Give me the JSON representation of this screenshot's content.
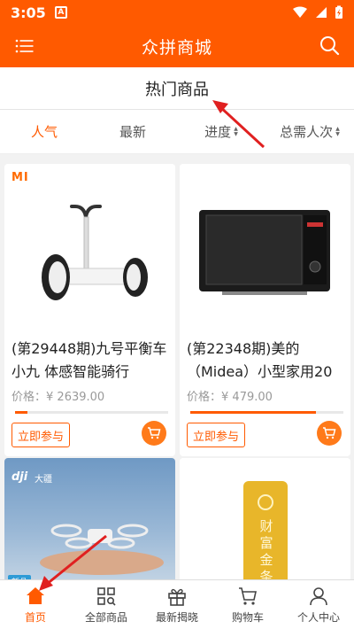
{
  "status_bar": {
    "time": "3:05",
    "notification_letter": "A"
  },
  "app_bar": {
    "title": "众拼商城",
    "menu_icon": "menu-icon",
    "search_icon": "search-icon"
  },
  "section": {
    "title": "热门商品"
  },
  "sort_tabs": [
    {
      "label": "人气",
      "active": true
    },
    {
      "label": "最新",
      "active": false
    },
    {
      "label": "进度",
      "active": false,
      "sortable": true
    },
    {
      "label": "总需人次",
      "active": false,
      "sortable": true
    }
  ],
  "products": [
    {
      "brand": "MI",
      "title": "(第29448期)九号平衡车 小九 体感智能骑行",
      "price_label": "价格：",
      "price": "¥ 2639.00",
      "progress": 0.08,
      "join_label": "立即参与"
    },
    {
      "brand": "Midea",
      "title": "(第22348期)美的（Midea）小型家用20",
      "price_label": "价格：",
      "price": "¥ 479.00",
      "progress": 0.82,
      "join_label": "立即参与"
    },
    {
      "brand": "大疆",
      "logo_text": "dji",
      "tag": "新品"
    },
    {
      "brand_text": "财富金条"
    }
  ],
  "tab_bar": [
    {
      "label": "首页",
      "icon": "home-icon",
      "active": true
    },
    {
      "label": "全部商品",
      "icon": "grid-search-icon",
      "active": false
    },
    {
      "label": "最新揭晓",
      "icon": "gift-icon",
      "active": false
    },
    {
      "label": "购物车",
      "icon": "cart-icon",
      "active": false
    },
    {
      "label": "个人中心",
      "icon": "user-icon",
      "active": false
    }
  ],
  "colors": {
    "brand": "#ff5a00",
    "annotation": "#e02020"
  }
}
